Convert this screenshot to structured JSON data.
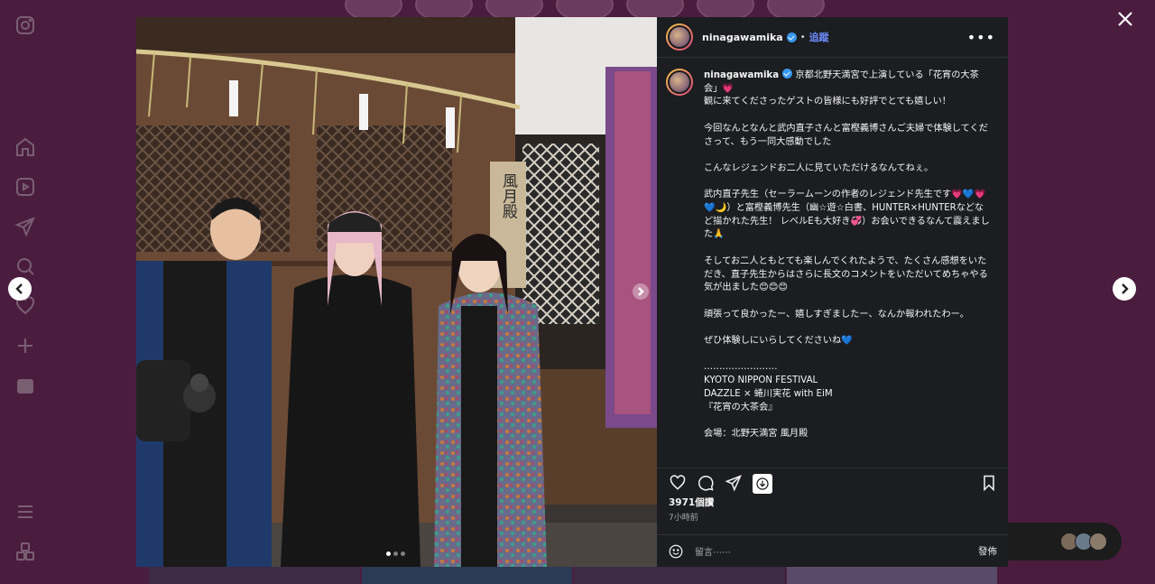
{
  "sidebar": {
    "icons": [
      "instagram-icon",
      "home-icon",
      "reels-icon",
      "direct-icon",
      "search-icon",
      "heart-icon",
      "create-icon",
      "profile-icon",
      "menu-icon",
      "threads-icon"
    ]
  },
  "post": {
    "username": "ninagawamika",
    "follow_label": "追蹤",
    "separator": "•",
    "more_label": "•••",
    "caption": "京都北野天満宮で上演している「花宵の大茶会」💗\n観に来てくださったゲストの皆様にも好評でとても嬉しい！\n\n今回なんとなんと武内直子さんと富樫義博さんご夫婦で体験してくださって、もう一同大感動でした\n\nこんなレジェンドお二人に見ていただけるなんてねぇ。\n\n武内直子先生（セーラームーンの作者のレジェンド先生です💗💙💗💙🌙）と富樫義博先生（幽☆遊☆白書、HUNTER×HUNTERなどなど描かれた先生！ レベルEも大好き💞）お会いできるなんて震えました🙏\n\nそしてお二人ともとても楽しんでくれたようで、たくさん感想をいただき、直子先生からはさらに長文のコメントをいただいてめちゃやる気が出ました😊😊😊\n\n頑張って良かったー、嬉しすぎましたー、なんか報われたわー。\n\nぜひ体験しにいらしてくださいね💙\n\n……………………\nKYOTO NIPPON FESTIVAL\nDAZZLE × 蜷川実花 with EiM\n『花宵の大茶会』\n\n会場：北野天満宮 風月殿",
    "likes": "3971個讚",
    "time_ago": "7小時前",
    "comment_placeholder": "留言⋯⋯",
    "post_button": "發佈",
    "photo_sign_text": "風月殿",
    "carousel_total": 3,
    "carousel_index": 1
  },
  "colors": {
    "page_bg": "#4a1d3f",
    "panel_bg": "#1b1d20",
    "link_blue": "#6f8cff",
    "verified_blue": "#3897f0"
  }
}
